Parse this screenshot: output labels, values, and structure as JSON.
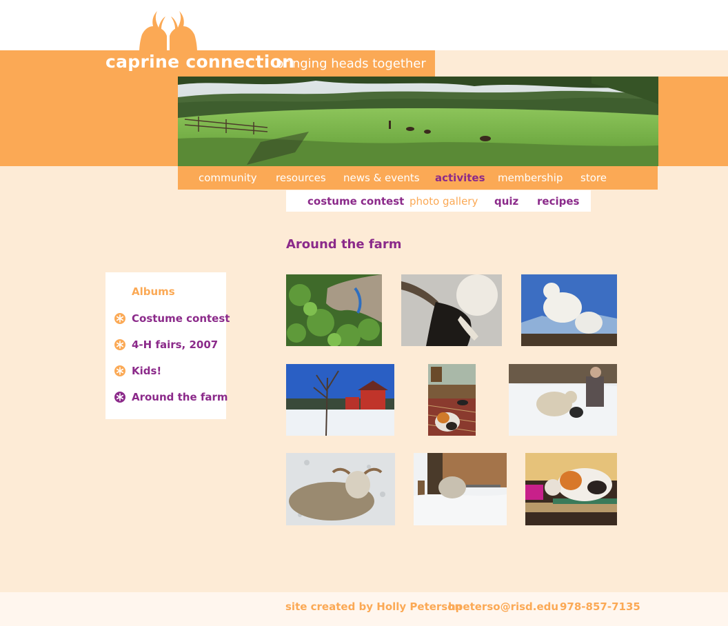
{
  "header": {
    "site_name": "caprine connection",
    "tagline": "bringing heads together"
  },
  "nav": {
    "items": [
      {
        "label": "community"
      },
      {
        "label": "resources"
      },
      {
        "label": "news & events"
      },
      {
        "label": "activites",
        "active": true
      },
      {
        "label": "membership"
      },
      {
        "label": "store"
      }
    ]
  },
  "subnav": {
    "items": [
      {
        "label": "costume contest"
      },
      {
        "label": "photo gallery",
        "active": true
      },
      {
        "label": "quiz"
      },
      {
        "label": "recipes"
      }
    ]
  },
  "page": {
    "title": "Around the farm"
  },
  "sidebar": {
    "title": "Albums",
    "items": [
      {
        "label": "Costume contest",
        "icon": "asterisk-flower-icon"
      },
      {
        "label": "4-H fairs, 2007",
        "icon": "asterisk-flower-icon"
      },
      {
        "label": "Kids!",
        "icon": "asterisk-flower-icon"
      },
      {
        "label": "Around the farm",
        "icon": "asterisk-flower-icon",
        "active": true
      }
    ]
  },
  "gallery": {
    "photos": [
      {
        "subject": "goat-grazing"
      },
      {
        "subject": "goat-horns-sky"
      },
      {
        "subject": "white-goat-kids"
      },
      {
        "subject": "red-barn-snow"
      },
      {
        "subject": "calico-cat-rug"
      },
      {
        "subject": "sheep-snow-person"
      },
      {
        "subject": "angora-goat-snow"
      },
      {
        "subject": "goat-shed-snow"
      },
      {
        "subject": "calico-cat-bench"
      }
    ]
  },
  "footer": {
    "credit": "site created by Holly Peterson",
    "email": "hpeterso@risd.edu",
    "phone": "978-857-7135"
  },
  "colors": {
    "orange": "#fba955",
    "purple": "#8b2a8a",
    "cream": "#fdebd6",
    "white": "#ffffff"
  }
}
